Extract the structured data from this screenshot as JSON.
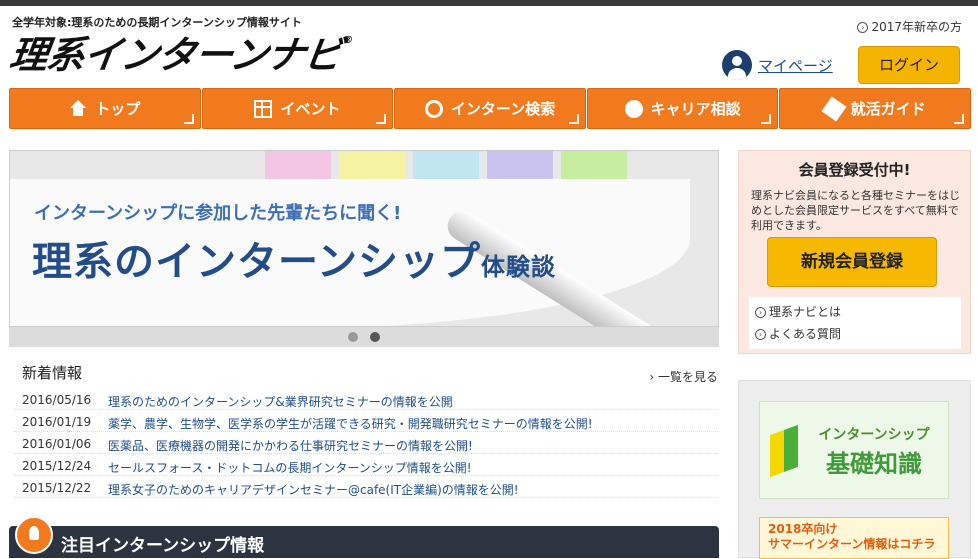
{
  "header": {
    "tagline": "全学年対象:理系のための長期インターンシップ情報サイト",
    "logo_text": "理系インターンナビ",
    "logo_mark": "®",
    "grad_link": "2017年新卒の方",
    "mypage_label": "マイページ",
    "login_label": "ログイン"
  },
  "nav": {
    "items": [
      {
        "label": "トップ",
        "icon": "home-icon"
      },
      {
        "label": "イベント",
        "icon": "calendar-icon"
      },
      {
        "label": "インターン検索",
        "icon": "search-icon"
      },
      {
        "label": "キャリア相談",
        "icon": "chat-icon"
      },
      {
        "label": "就活ガイド",
        "icon": "pen-icon"
      }
    ]
  },
  "banner": {
    "sub": "インターンシップに参加した先輩たちに聞く!",
    "main": "理系のインターンシップ",
    "main_small": "体験談",
    "tab_colors": [
      "#f4c6e6",
      "#f3f3a2",
      "#bfe6f1",
      "#c9c1ee",
      "#c7ee9f"
    ],
    "slide_count": 2,
    "active_slide": 2
  },
  "news": {
    "title": "新着情報",
    "more": "一覧を見る",
    "items": [
      {
        "date": "2016/05/16",
        "text": "理系のためのインターンシップ&業界研究セミナーの情報を公開"
      },
      {
        "date": "2016/01/19",
        "text": "薬学、農学、生物学、医学系の学生が活躍できる研究・開発職研究セミナーの情報を公開!"
      },
      {
        "date": "2016/01/06",
        "text": "医薬品、医療機器の開発にかかわる仕事研究セミナーの情報を公開!"
      },
      {
        "date": "2015/12/24",
        "text": "セールスフォース・ドットコムの長期インターンシップ情報を公開!"
      },
      {
        "date": "2015/12/22",
        "text": "理系女子のためのキャリアデザインセミナー@cafe(IT企業編)の情報を公開!"
      }
    ]
  },
  "feature": {
    "title": "注目インターンシップ情報"
  },
  "sidebar": {
    "register": {
      "title": "会員登録受付中!",
      "desc": "理系ナビ会員になると各種セミナーをはじめとした会員限定サービスをすべて無料で利用できます。",
      "button": "新規会員登録",
      "links": [
        "理系ナビとは",
        "よくある質問"
      ]
    },
    "basics": {
      "top": "インターンシップ",
      "main": "基礎知識"
    },
    "summer": {
      "line1": "2018卒向け",
      "line2": "サマーインターン情報はコチラ"
    }
  },
  "colors": {
    "nav": "#f07a1d",
    "login": "#f5b400",
    "link": "#1f4e8a",
    "banner_title": "#234d88"
  }
}
